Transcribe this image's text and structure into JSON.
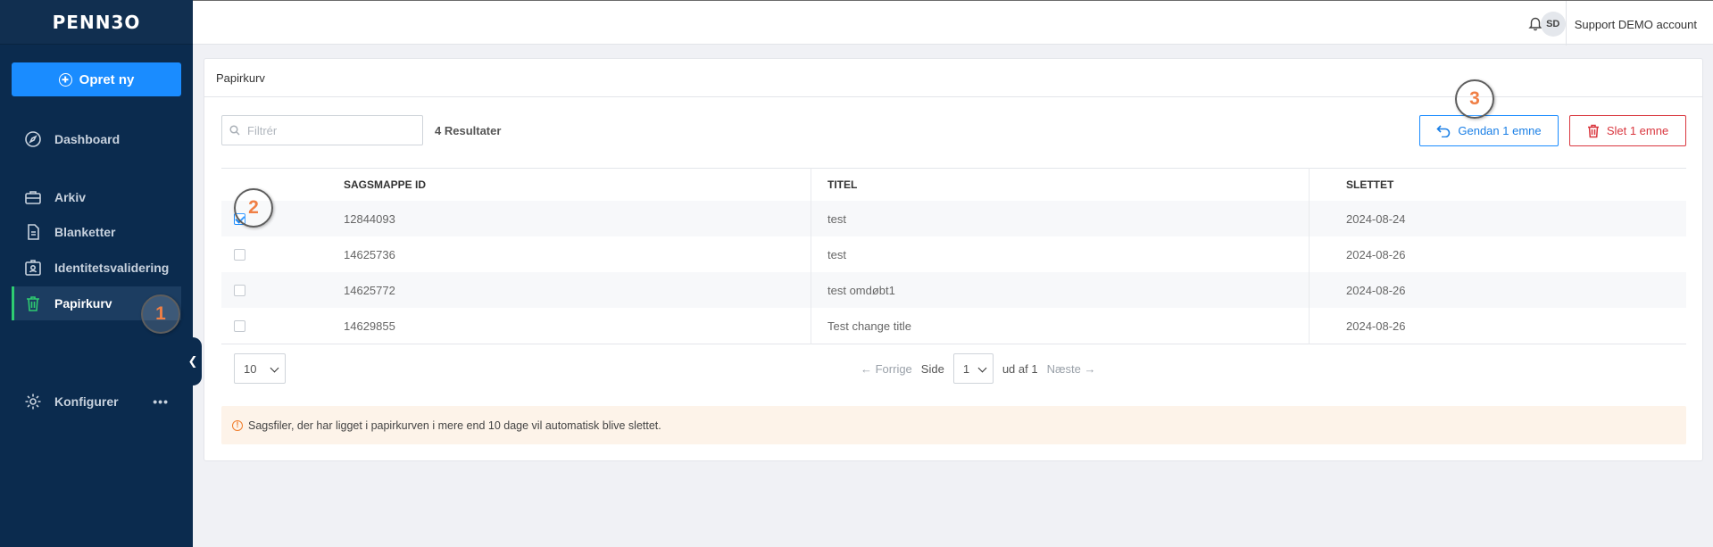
{
  "sidebar": {
    "logo": "PENN3O",
    "create_label": "Opret ny",
    "items": [
      {
        "label": "Dashboard"
      },
      {
        "label": "Arkiv"
      },
      {
        "label": "Blanketter"
      },
      {
        "label": "Identitetsvalidering"
      },
      {
        "label": "Papirkurv"
      },
      {
        "label": "Konfigurer"
      }
    ],
    "more_label": "•••",
    "collapse_glyph": "❮"
  },
  "header": {
    "avatar_initials": "SD",
    "account_name": "Support DEMO account"
  },
  "main": {
    "title": "Papirkurv",
    "filter_placeholder": "Filtrér",
    "results": "4 Resultater",
    "restore_label": "Gendan 1 emne",
    "delete_label": "Slet 1 emne",
    "columns": [
      "SAGSMAPPE ID",
      "TITEL",
      "SLETTET"
    ],
    "rows": [
      {
        "id": "12844093",
        "title": "test",
        "deleted": "2024-08-24",
        "checked": true
      },
      {
        "id": "14625736",
        "title": "test",
        "deleted": "2024-08-26",
        "checked": false
      },
      {
        "id": "14625772",
        "title": "test omdøbt1",
        "deleted": "2024-08-26",
        "checked": false
      },
      {
        "id": "14629855",
        "title": "Test change title",
        "deleted": "2024-08-26",
        "checked": false
      }
    ],
    "page_size": "10",
    "pagination": {
      "prev": "← Forrige",
      "page_label": "Side",
      "page_value": "1",
      "of_label": "ud af 1",
      "next": "Næste →"
    },
    "notice": "Sagsfiler, der har ligget i papirkurven i mere end 10 dage vil automatisk blive slettet.",
    "notice_icon": "!"
  },
  "markers": [
    "1",
    "2",
    "3"
  ],
  "colors": {
    "sidebar": "#0b2b4e",
    "primary": "#1a8cff",
    "danger": "#d9363e",
    "active_accent": "#2ecc71",
    "marker": "#f07f45"
  }
}
